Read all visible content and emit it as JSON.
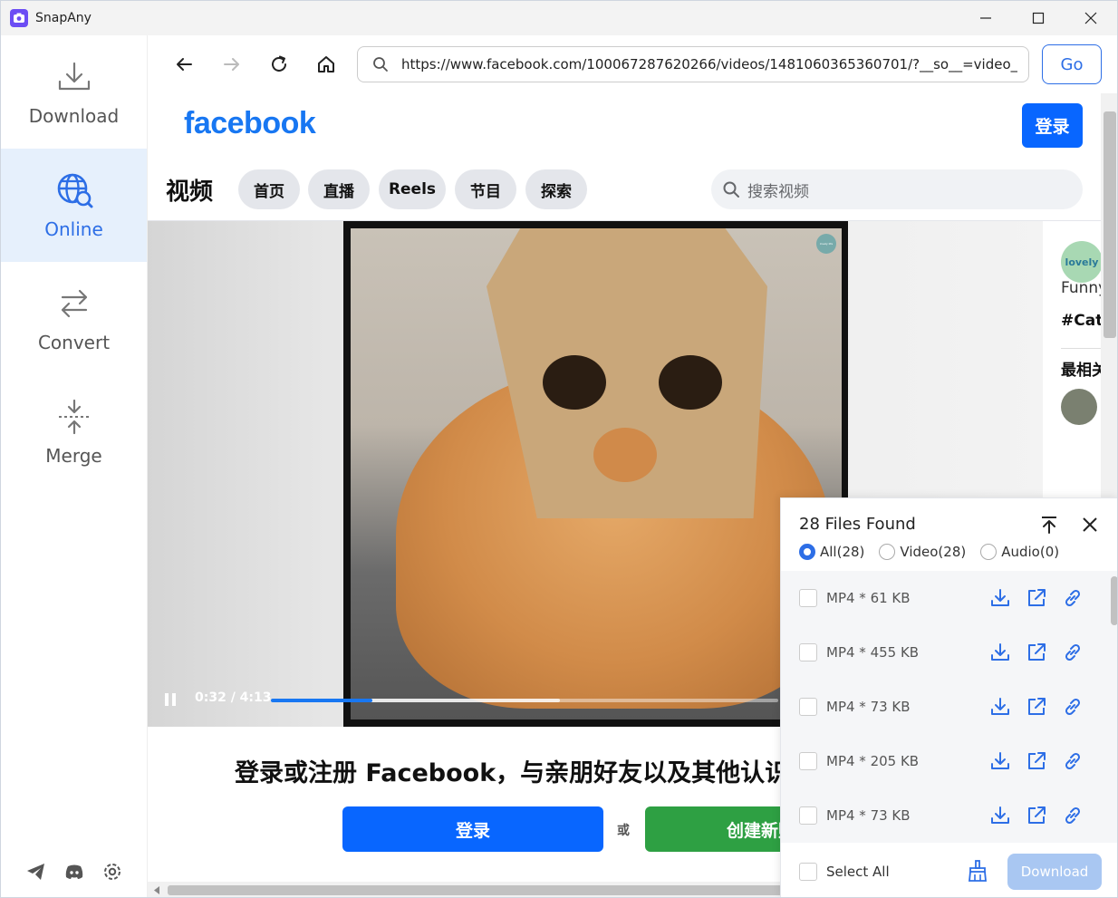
{
  "app": {
    "title": "SnapAny",
    "accent": "#2d6ee6"
  },
  "sidebar": {
    "items": [
      {
        "label": "Download",
        "icon": "download-icon",
        "active": false
      },
      {
        "label": "Online",
        "icon": "globe-search-icon",
        "active": true
      },
      {
        "label": "Convert",
        "icon": "convert-arrows-icon",
        "active": false
      },
      {
        "label": "Merge",
        "icon": "merge-icon",
        "active": false
      }
    ],
    "bottom_icons": [
      "telegram-icon",
      "discord-icon",
      "settings-gear-icon"
    ]
  },
  "browser": {
    "url": "https://www.facebook.com/100067287620266/videos/1481060365360701/?__so__=video_home",
    "go_label": "Go"
  },
  "facebook": {
    "logo": "facebook",
    "login_label": "登录",
    "section_title": "视频",
    "tabs": [
      "首页",
      "直播",
      "Reels",
      "节目",
      "探索"
    ],
    "search_placeholder": "搜索视频",
    "video": {
      "time": "0:32 / 4:13",
      "progress": 0.2,
      "buffered": 0.57,
      "watermark": "lovely life"
    },
    "right_panel": {
      "line1": "Funny",
      "line2": "#Cats",
      "related": "最相关"
    },
    "signup_title": "登录或注册 Facebook，与亲朋好友以及其他认识的人分享",
    "big_login_label": "登录",
    "or_label": "或",
    "create_label": "创建新账户"
  },
  "files_panel": {
    "title": "28 Files Found",
    "filters": [
      {
        "label": "All(28)",
        "selected": true
      },
      {
        "label": "Video(28)",
        "selected": false
      },
      {
        "label": "Audio(0)",
        "selected": false
      }
    ],
    "rows": [
      {
        "label": "MP4 * 61 KB"
      },
      {
        "label": "MP4 * 455 KB"
      },
      {
        "label": "MP4 * 73 KB"
      },
      {
        "label": "MP4 * 205 KB"
      },
      {
        "label": "MP4 * 73 KB"
      }
    ],
    "select_all_label": "Select All",
    "download_label": "Download"
  }
}
